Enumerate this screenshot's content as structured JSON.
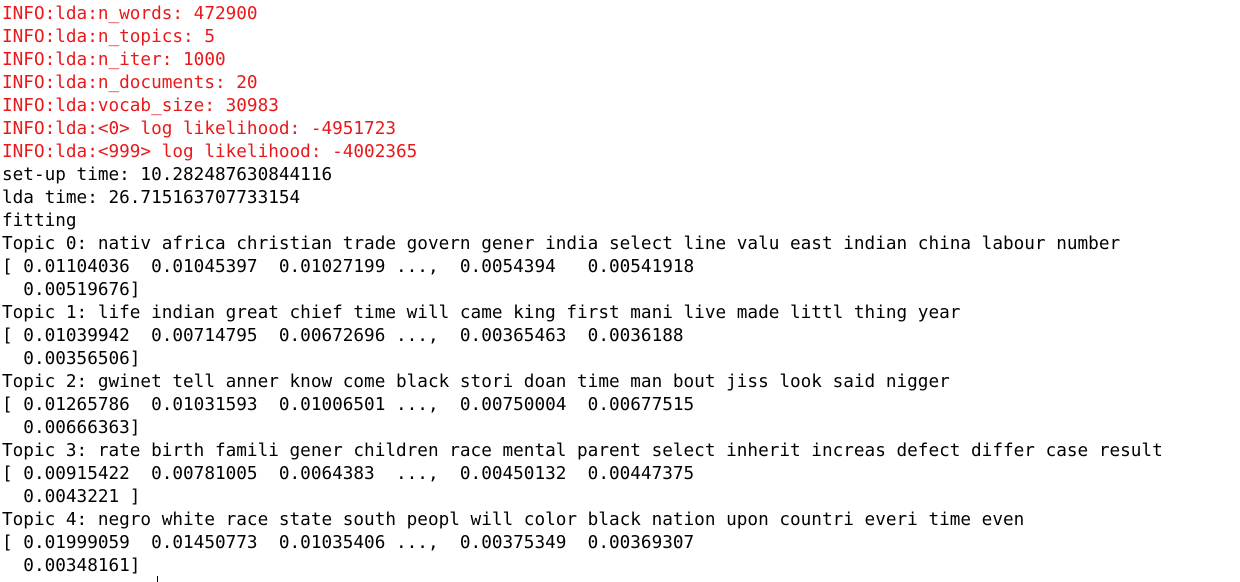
{
  "console": {
    "info_lines": [
      "INFO:lda:n_words: 472900",
      "INFO:lda:n_topics: 5",
      "INFO:lda:n_iter: 1000",
      "INFO:lda:n_documents: 20",
      "INFO:lda:vocab_size: 30983",
      "INFO:lda:<0> log likelihood: -4951723",
      "INFO:lda:<999> log likelihood: -4002365"
    ],
    "setup_time": "set-up time: 10.282487630844116",
    "lda_time": "lda time: 26.715163707733154",
    "fitting": "fitting",
    "topics": [
      {
        "label": "Topic 0: nativ africa christian trade govern gener india select line valu east indian china labour number",
        "weights_line1": "[ 0.01104036  0.01045397  0.01027199 ...,  0.0054394   0.00541918",
        "weights_line2": "  0.00519676]"
      },
      {
        "label": "Topic 1: life indian great chief time will came king first mani live made littl thing year",
        "weights_line1": "[ 0.01039942  0.00714795  0.00672696 ...,  0.00365463  0.0036188",
        "weights_line2": "  0.00356506]"
      },
      {
        "label": "Topic 2: gwinet tell anner know come black stori doan time man bout jiss look said nigger",
        "weights_line1": "[ 0.01265786  0.01031593  0.01006501 ...,  0.00750004  0.00677515",
        "weights_line2": "  0.00666363]"
      },
      {
        "label": "Topic 3: rate birth famili gener children race mental parent select inherit increas defect differ case result",
        "weights_line1": "[ 0.00915422  0.00781005  0.0064383  ...,  0.00450132  0.00447375",
        "weights_line2": "  0.0043221 ]"
      },
      {
        "label": "Topic 4: negro white race state south peopl will color black nation upon countri everi time even",
        "weights_line1": "[ 0.01999059  0.01450773  0.01035406 ...,  0.00375349  0.00369307",
        "weights_line2": "  0.00348161]"
      }
    ]
  }
}
